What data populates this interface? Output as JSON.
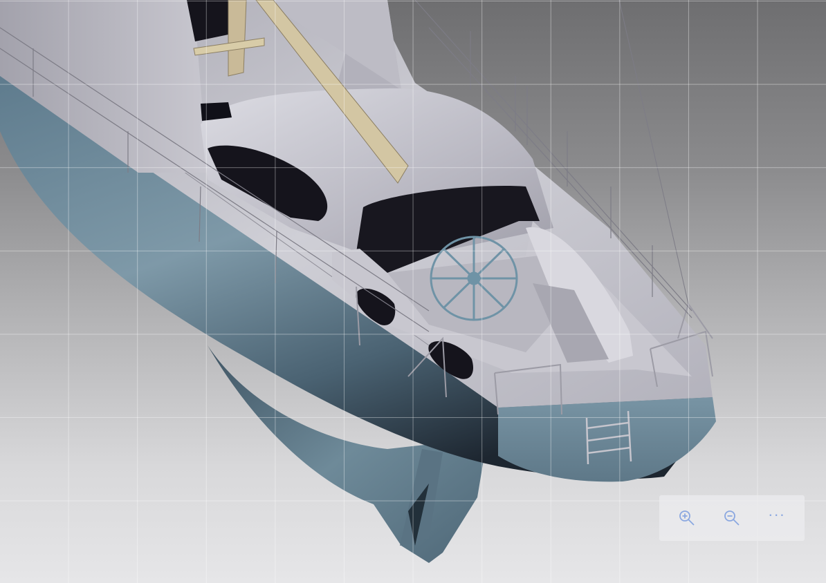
{
  "viewer": {
    "model": "sailboat-stern-3d-render",
    "background_top": "#6e6e70",
    "background_bottom": "#e6e6e8",
    "hull_color": "#6e8c9c",
    "deck_color": "#c4c3cb",
    "grid_visible": true
  },
  "toolbar": {
    "accent": "#8aa7e0",
    "zoom_in_icon": "zoom-in-icon",
    "zoom_out_icon": "zoom-out-icon",
    "more_label": "···"
  }
}
